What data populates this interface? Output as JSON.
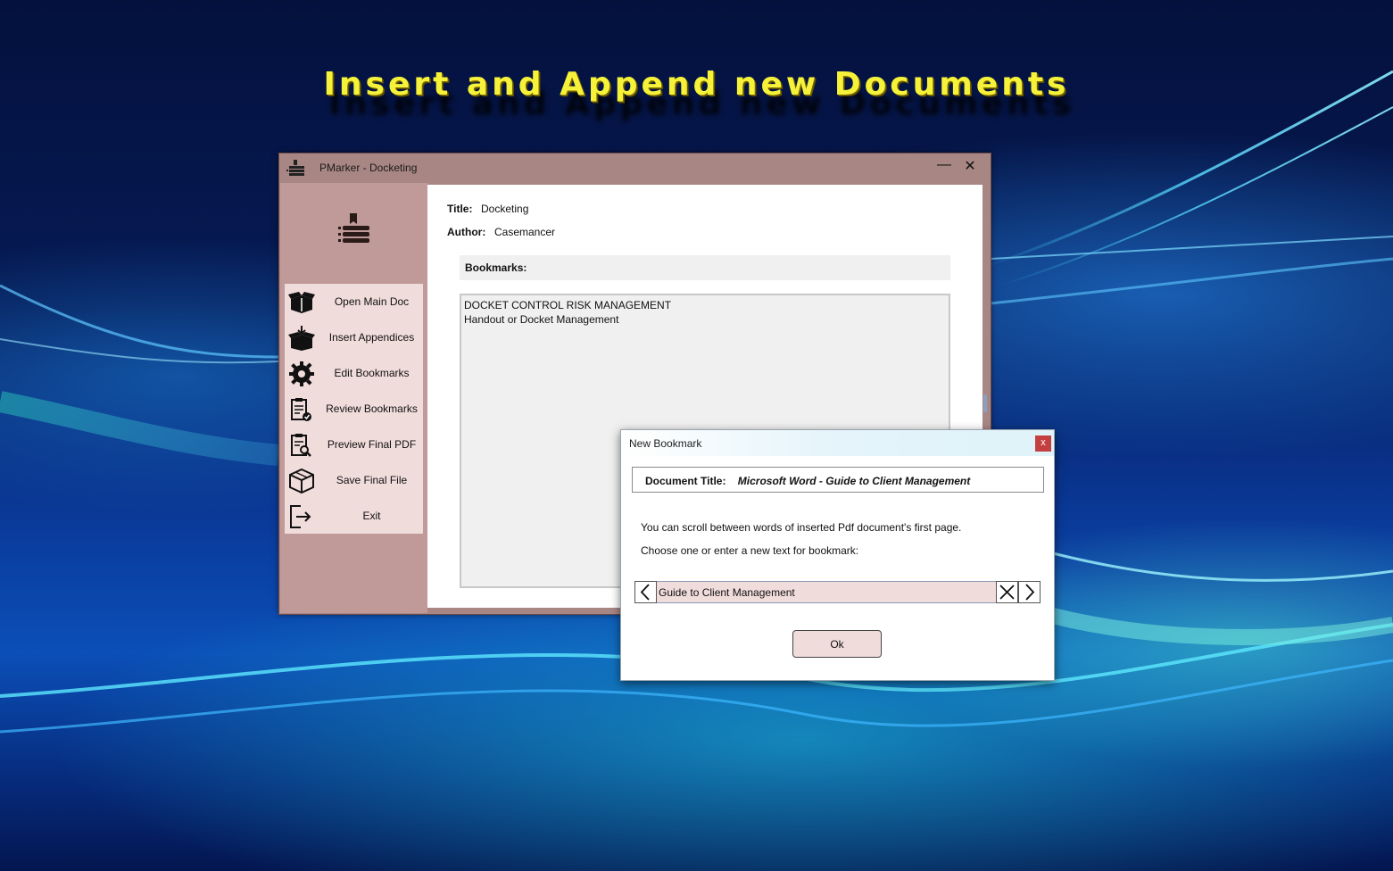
{
  "headline": "Insert and Append new Documents",
  "window": {
    "title": "PMarker - Docketing",
    "minimize_glyph": "—",
    "close_glyph": "✕"
  },
  "sidebar": {
    "items": [
      {
        "label": "Open Main Doc",
        "icon": "open-box-icon"
      },
      {
        "label": "Insert Appendices",
        "icon": "insert-box-icon"
      },
      {
        "label": "Edit Bookmarks",
        "icon": "gear-icon"
      },
      {
        "label": "Review Bookmarks",
        "icon": "clipboard-check-icon"
      },
      {
        "label": "Preview Final PDF",
        "icon": "clipboard-search-icon"
      },
      {
        "label": "Save Final File",
        "icon": "cube-icon"
      },
      {
        "label": "Exit",
        "icon": "exit-icon"
      }
    ]
  },
  "doc": {
    "title_label": "Title:",
    "title_value": "Docketing",
    "author_label": "Author:",
    "author_value": "Casemancer",
    "bookmarks_label": "Bookmarks:",
    "bookmarks": [
      "DOCKET CONTROL RISK MANAGEMENT",
      "Handout or Docket Management"
    ]
  },
  "dialog": {
    "title": "New Bookmark",
    "close_glyph": "x",
    "doc_title_label": "Document Title:",
    "doc_title_value": "Microsoft Word - Guide to Client Management",
    "line1": "You can scroll between words of inserted Pdf document's first page.",
    "line2": "Choose one or enter a new text for bookmark:",
    "input_value": "Guide to Client Management",
    "ok_label": "Ok"
  },
  "colors": {
    "headline": "#f6f23a",
    "window_frame": "#a88684",
    "sidebar": "#c09a98",
    "menu_bg": "#f0dcdb",
    "dialog_close": "#c44040"
  }
}
